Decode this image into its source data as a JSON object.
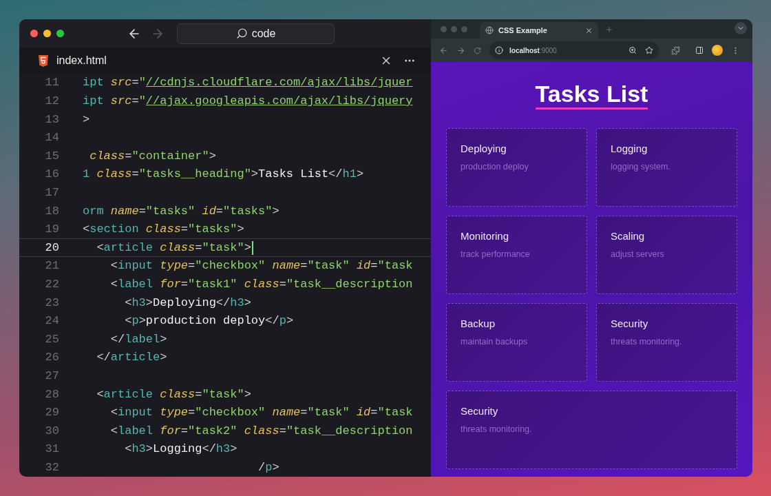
{
  "editor": {
    "search": "code",
    "tab": {
      "label": "index.html"
    },
    "lines": [
      {
        "number": "11",
        "current": false,
        "tokens": [
          {
            "kind": "tag",
            "text": "ipt"
          },
          {
            "kind": "attr",
            "text": " src"
          },
          {
            "kind": "punct",
            "text": "="
          },
          {
            "kind": "str",
            "text": "\""
          },
          {
            "kind": "link",
            "text": "//cdnjs.cloudflare.com/ajax/libs/jquer"
          }
        ]
      },
      {
        "number": "12",
        "current": false,
        "tokens": [
          {
            "kind": "tag",
            "text": "ipt"
          },
          {
            "kind": "attr",
            "text": " src"
          },
          {
            "kind": "punct",
            "text": "="
          },
          {
            "kind": "str",
            "text": "\""
          },
          {
            "kind": "link",
            "text": "//ajax.googleapis.com/ajax/libs/jquery"
          }
        ]
      },
      {
        "number": "13",
        "current": false,
        "tokens": [
          {
            "kind": "punct",
            "text": ">"
          }
        ]
      },
      {
        "number": "14",
        "current": false
      },
      {
        "number": "15",
        "current": false,
        "tokens": [
          {
            "kind": "attr",
            "text": " class"
          },
          {
            "kind": "punct",
            "text": "="
          },
          {
            "kind": "str",
            "text": "\"container\""
          },
          {
            "kind": "punct",
            "text": ">"
          }
        ]
      },
      {
        "number": "16",
        "current": false,
        "tokens": [
          {
            "kind": "tag",
            "text": "1"
          },
          {
            "kind": "attr",
            "text": " class"
          },
          {
            "kind": "punct",
            "text": "="
          },
          {
            "kind": "str",
            "text": "\"tasks__heading\""
          },
          {
            "kind": "punct",
            "text": ">"
          },
          {
            "kind": "text",
            "text": "Tasks List"
          },
          {
            "kind": "punct",
            "text": "</"
          },
          {
            "kind": "tag",
            "text": "h1"
          },
          {
            "kind": "punct",
            "text": ">"
          }
        ]
      },
      {
        "number": "17",
        "current": false
      },
      {
        "number": "18",
        "current": false,
        "tokens": [
          {
            "kind": "tag",
            "text": "orm"
          },
          {
            "kind": "attr",
            "text": " name"
          },
          {
            "kind": "punct",
            "text": "="
          },
          {
            "kind": "str",
            "text": "\"tasks\""
          },
          {
            "kind": "attr",
            "text": " id"
          },
          {
            "kind": "punct",
            "text": "="
          },
          {
            "kind": "str",
            "text": "\"tasks\""
          },
          {
            "kind": "punct",
            "text": ">"
          }
        ]
      },
      {
        "number": "19",
        "current": false,
        "tokens": [
          {
            "kind": "punct",
            "text": "<"
          },
          {
            "kind": "tag",
            "text": "section"
          },
          {
            "kind": "attr",
            "text": " class"
          },
          {
            "kind": "punct",
            "text": "="
          },
          {
            "kind": "str",
            "text": "\"tasks\""
          },
          {
            "kind": "punct",
            "text": ">"
          }
        ]
      },
      {
        "number": "20",
        "current": true,
        "tokens": [
          {
            "kind": "punct",
            "text": "  <"
          },
          {
            "kind": "tag",
            "text": "article"
          },
          {
            "kind": "attr",
            "text": " class"
          },
          {
            "kind": "punct",
            "text": "="
          },
          {
            "kind": "str",
            "text": "\"task\""
          },
          {
            "kind": "punct",
            "text": ">"
          }
        ]
      },
      {
        "number": "21",
        "current": false,
        "tokens": [
          {
            "kind": "punct",
            "text": "    <"
          },
          {
            "kind": "tag",
            "text": "input"
          },
          {
            "kind": "attr",
            "text": " type"
          },
          {
            "kind": "punct",
            "text": "="
          },
          {
            "kind": "str",
            "text": "\"checkbox\""
          },
          {
            "kind": "attr",
            "text": " name"
          },
          {
            "kind": "punct",
            "text": "="
          },
          {
            "kind": "str",
            "text": "\"task\""
          },
          {
            "kind": "attr",
            "text": " id"
          },
          {
            "kind": "punct",
            "text": "="
          },
          {
            "kind": "str",
            "text": "\"task"
          }
        ]
      },
      {
        "number": "22",
        "current": false,
        "tokens": [
          {
            "kind": "punct",
            "text": "    <"
          },
          {
            "kind": "tag",
            "text": "label"
          },
          {
            "kind": "attr",
            "text": " for"
          },
          {
            "kind": "punct",
            "text": "="
          },
          {
            "kind": "str",
            "text": "\"task1\""
          },
          {
            "kind": "attr",
            "text": " class"
          },
          {
            "kind": "punct",
            "text": "="
          },
          {
            "kind": "str",
            "text": "\"task__description"
          }
        ]
      },
      {
        "number": "23",
        "current": false,
        "tokens": [
          {
            "kind": "punct",
            "text": "      <"
          },
          {
            "kind": "tag",
            "text": "h3"
          },
          {
            "kind": "punct",
            "text": ">"
          },
          {
            "kind": "text",
            "text": "Deploying"
          },
          {
            "kind": "punct",
            "text": "</"
          },
          {
            "kind": "tag",
            "text": "h3"
          },
          {
            "kind": "punct",
            "text": ">"
          }
        ]
      },
      {
        "number": "24",
        "current": false,
        "tokens": [
          {
            "kind": "punct",
            "text": "      <"
          },
          {
            "kind": "tag",
            "text": "p"
          },
          {
            "kind": "punct",
            "text": ">"
          },
          {
            "kind": "text",
            "text": "production deploy"
          },
          {
            "kind": "punct",
            "text": "</"
          },
          {
            "kind": "tag",
            "text": "p"
          },
          {
            "kind": "punct",
            "text": ">"
          }
        ]
      },
      {
        "number": "25",
        "current": false,
        "tokens": [
          {
            "kind": "punct",
            "text": "    </"
          },
          {
            "kind": "tag",
            "text": "label"
          },
          {
            "kind": "punct",
            "text": ">"
          }
        ]
      },
      {
        "number": "26",
        "current": false,
        "tokens": [
          {
            "kind": "punct",
            "text": "  </"
          },
          {
            "kind": "tag",
            "text": "article"
          },
          {
            "kind": "punct",
            "text": ">"
          }
        ]
      },
      {
        "number": "27",
        "current": false
      },
      {
        "number": "28",
        "current": false,
        "tokens": [
          {
            "kind": "punct",
            "text": "  <"
          },
          {
            "kind": "tag",
            "text": "article"
          },
          {
            "kind": "attr",
            "text": " class"
          },
          {
            "kind": "punct",
            "text": "="
          },
          {
            "kind": "str",
            "text": "\"task\""
          },
          {
            "kind": "punct",
            "text": ">"
          }
        ]
      },
      {
        "number": "29",
        "current": false,
        "tokens": [
          {
            "kind": "punct",
            "text": "    <"
          },
          {
            "kind": "tag",
            "text": "input"
          },
          {
            "kind": "attr",
            "text": " type"
          },
          {
            "kind": "punct",
            "text": "="
          },
          {
            "kind": "str",
            "text": "\"checkbox\""
          },
          {
            "kind": "attr",
            "text": " name"
          },
          {
            "kind": "punct",
            "text": "="
          },
          {
            "kind": "str",
            "text": "\"task\""
          },
          {
            "kind": "attr",
            "text": " id"
          },
          {
            "kind": "punct",
            "text": "="
          },
          {
            "kind": "str",
            "text": "\"task"
          }
        ]
      },
      {
        "number": "30",
        "current": false,
        "tokens": [
          {
            "kind": "punct",
            "text": "    <"
          },
          {
            "kind": "tag",
            "text": "label"
          },
          {
            "kind": "attr",
            "text": " for"
          },
          {
            "kind": "punct",
            "text": "="
          },
          {
            "kind": "str",
            "text": "\"task2\""
          },
          {
            "kind": "attr",
            "text": " class"
          },
          {
            "kind": "punct",
            "text": "="
          },
          {
            "kind": "str",
            "text": "\"task__description"
          }
        ]
      },
      {
        "number": "31",
        "current": false,
        "tokens": [
          {
            "kind": "punct",
            "text": "      <"
          },
          {
            "kind": "tag",
            "text": "h3"
          },
          {
            "kind": "punct",
            "text": ">"
          },
          {
            "kind": "text",
            "text": "Logging"
          },
          {
            "kind": "punct",
            "text": "</"
          },
          {
            "kind": "tag",
            "text": "h3"
          },
          {
            "kind": "punct",
            "text": ">"
          }
        ]
      },
      {
        "number": "32",
        "current": false,
        "tokens": [
          {
            "kind": "punct",
            "text": "                         /"
          },
          {
            "kind": "tag",
            "text": "p"
          },
          {
            "kind": "punct",
            "text": ">"
          }
        ]
      }
    ]
  },
  "browser": {
    "tab": {
      "title": "CSS Example"
    },
    "url": {
      "host": "localhost",
      "port": ":9000"
    },
    "page": {
      "heading": "Tasks List",
      "tasks": [
        {
          "title": "Deploying",
          "description": "production deploy"
        },
        {
          "title": "Logging",
          "description": "logging system."
        },
        {
          "title": "Monitoring",
          "description": "track performance"
        },
        {
          "title": "Scaling",
          "description": "adjust servers"
        },
        {
          "title": "Backup",
          "description": "maintain backups"
        },
        {
          "title": "Security",
          "description": "threats monitoring."
        },
        {
          "title": "Security",
          "description": "threats monitoring."
        }
      ]
    }
  }
}
